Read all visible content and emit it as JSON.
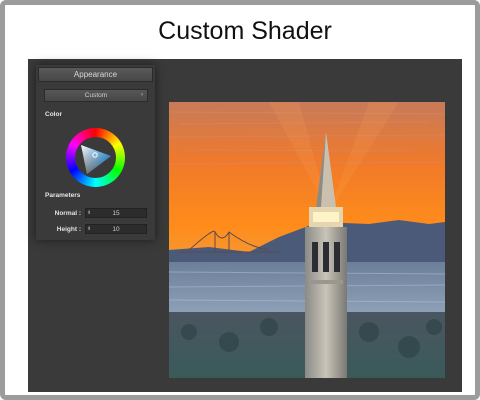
{
  "title": "Custom Shader",
  "panel": {
    "header": "Appearance",
    "dropdown_value": "Custom",
    "dropdown_arrow": "›",
    "color_label": "Color",
    "parameters_label": "Parameters",
    "params": [
      {
        "label": "Normal :",
        "value": "15",
        "arrows": "⬍"
      },
      {
        "label": "Height :",
        "value": "10",
        "arrows": "⬍"
      }
    ]
  },
  "colors": {
    "viewport": "#3a3a3a",
    "picker_selected": "#33aaff"
  },
  "image": {
    "subject": "Sather Tower at sunset with Golden Gate Bridge in background (stylized shader render)"
  }
}
